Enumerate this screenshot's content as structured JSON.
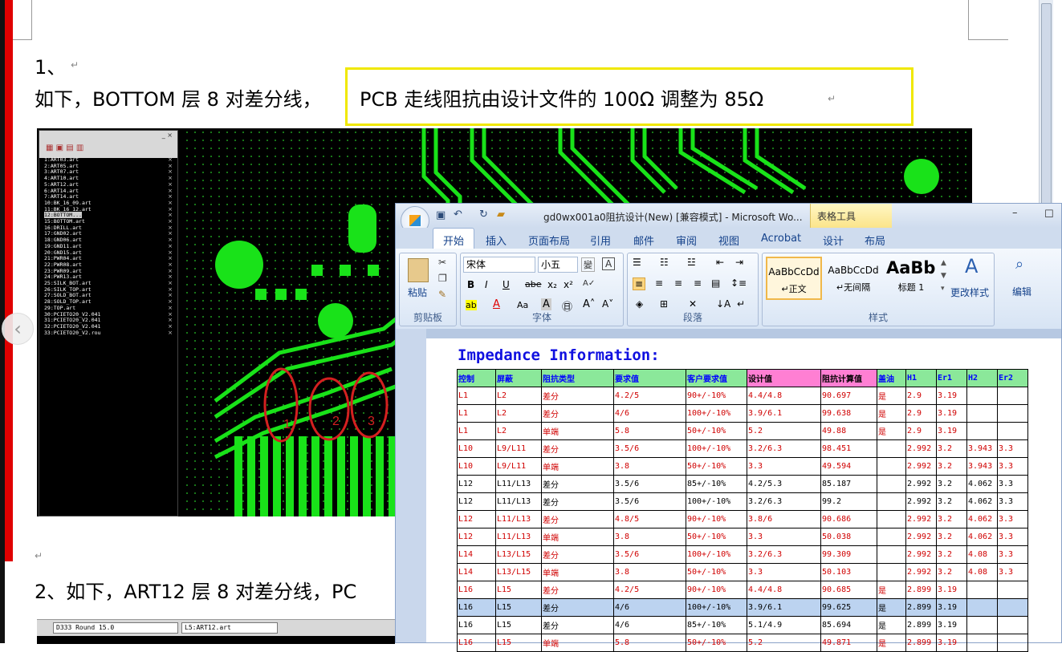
{
  "doc": {
    "item1": "1、",
    "para1_a": "如下，BOTTOM 层 8 对差分线，",
    "para1_b": "PCB 走线阻抗由设计文件的 100Ω 调整为 85Ω",
    "item2": "2、如下，ART12 层 8 对差分线，PC",
    "para_mark": "↵"
  },
  "pcb": {
    "layers": [
      "1:ART03.art",
      "2:ART05.art",
      "3:ART07.art",
      "4:ART10.art",
      "5:ART12.art",
      "6:ART14.art",
      "7:ART14.art",
      "10:BK_16_09.art",
      "11:BK_16_12.art",
      "12:BOTTOM...",
      "15:BOTTOM.art",
      "16:DRILL.art",
      "17:GND02.art",
      "18:GND06.art",
      "19:GND11.art",
      "20:GND15.art",
      "21:PWR04.art",
      "22:PWR08.art",
      "23:PWR09.art",
      "24:PWR13.art",
      "25:SILK_BOT.art",
      "26:SILK_TOP.art",
      "27:SOLD_BOT.art",
      "28:SOLD_TOP.art",
      "29:TOP.art",
      "30:PCIETO20_V2.041",
      "31:PCIETO20_V2.041",
      "32:PCIETO20_V2.041",
      "33:PCIETO20_V2.rou"
    ],
    "circle_labels": [
      "1",
      "2",
      "3"
    ],
    "bottom_toolbar": {
      "field1": "D333  Round 15.0",
      "field2": "L5:ART12.art"
    }
  },
  "word": {
    "title": "gd0wx001a0阻抗设计(New) [兼容模式] - Microsoft Wo...",
    "context_tab": "表格工具",
    "tabs": [
      "开始",
      "插入",
      "页面布局",
      "引用",
      "邮件",
      "审阅",
      "视图",
      "Acrobat",
      "设计",
      "布局"
    ],
    "paste": "粘贴",
    "font_name": "宋体",
    "font_size": "小五",
    "groups": [
      "剪贴板",
      "字体",
      "段落",
      "样式"
    ],
    "styles": [
      {
        "preview": "AaBbCcDd",
        "name": "↵正文"
      },
      {
        "preview": "AaBbCcDd",
        "name": "↵无间隔"
      },
      {
        "preview": "AaBb",
        "name": "标题 1"
      }
    ],
    "change_style": "更改样式",
    "edit": "编辑",
    "heading": "Impedance Information:",
    "columns": [
      "控制",
      "屏蔽",
      "阻抗类型",
      "要求值",
      "客户要求值",
      "设计值",
      "阻抗计算值",
      "盖油",
      "H1",
      "Er1",
      "H2",
      "Er2"
    ],
    "rows": [
      {
        "red": true,
        "sel": false,
        "c": [
          "L1",
          "L2",
          "差分",
          "4.2/5",
          "90+/-10%",
          "4.4/4.8",
          "90.697",
          "是",
          "2.9",
          "3.19",
          "",
          ""
        ]
      },
      {
        "red": true,
        "sel": false,
        "c": [
          "L1",
          "L2",
          "差分",
          "4/6",
          "100+/-10%",
          "3.9/6.1",
          "99.638",
          "是",
          "2.9",
          "3.19",
          "",
          ""
        ]
      },
      {
        "red": true,
        "sel": false,
        "c": [
          "L1",
          "L2",
          "单端",
          "5.8",
          "50+/-10%",
          "5.2",
          "49.88",
          "是",
          "2.9",
          "3.19",
          "",
          ""
        ]
      },
      {
        "red": true,
        "sel": false,
        "c": [
          "L10",
          "L9/L11",
          "差分",
          "3.5/6",
          "100+/-10%",
          "3.2/6.3",
          "98.451",
          "",
          "2.992",
          "3.2",
          "3.943",
          "3.3"
        ]
      },
      {
        "red": true,
        "sel": false,
        "c": [
          "L10",
          "L9/L11",
          "单端",
          "3.8",
          "50+/-10%",
          "3.3",
          "49.594",
          "",
          "2.992",
          "3.2",
          "3.943",
          "3.3"
        ]
      },
      {
        "red": false,
        "sel": false,
        "c": [
          "L12",
          "L11/L13",
          "差分",
          "3.5/6",
          "85+/-10%",
          "4.2/5.3",
          "85.187",
          "",
          "2.992",
          "3.2",
          "4.062",
          "3.3"
        ]
      },
      {
        "red": false,
        "sel": false,
        "c": [
          "L12",
          "L11/L13",
          "差分",
          "3.5/6",
          "100+/-10%",
          "3.2/6.3",
          "99.2",
          "",
          "2.992",
          "3.2",
          "4.062",
          "3.3"
        ]
      },
      {
        "red": true,
        "sel": false,
        "c": [
          "L12",
          "L11/L13",
          "差分",
          "4.8/5",
          "90+/-10%",
          "3.8/6",
          "90.686",
          "",
          "2.992",
          "3.2",
          "4.062",
          "3.3"
        ]
      },
      {
        "red": true,
        "sel": false,
        "c": [
          "L12",
          "L11/L13",
          "单端",
          "3.8",
          "50+/-10%",
          "3.3",
          "50.038",
          "",
          "2.992",
          "3.2",
          "4.062",
          "3.3"
        ]
      },
      {
        "red": true,
        "sel": false,
        "c": [
          "L14",
          "L13/L15",
          "差分",
          "3.5/6",
          "100+/-10%",
          "3.2/6.3",
          "99.309",
          "",
          "2.992",
          "3.2",
          "4.08",
          "3.3"
        ]
      },
      {
        "red": true,
        "sel": false,
        "c": [
          "L14",
          "L13/L15",
          "单端",
          "3.8",
          "50+/-10%",
          "3.3",
          "50.103",
          "",
          "2.992",
          "3.2",
          "4.08",
          "3.3"
        ]
      },
      {
        "red": true,
        "sel": false,
        "c": [
          "L16",
          "L15",
          "差分",
          "4.2/5",
          "90+/-10%",
          "4.4/4.8",
          "90.685",
          "是",
          "2.899",
          "3.19",
          "",
          ""
        ]
      },
      {
        "red": false,
        "sel": true,
        "c": [
          "L16",
          "L15",
          "差分",
          "4/6",
          "100+/-10%",
          "3.9/6.1",
          "99.625",
          "是",
          "2.899",
          "3.19",
          "",
          ""
        ]
      },
      {
        "red": false,
        "sel": false,
        "c": [
          "L16",
          "L15",
          "差分",
          "4/6",
          "85+/-10%",
          "5.1/4.9",
          "85.694",
          "是",
          "2.899",
          "3.19",
          "",
          ""
        ]
      },
      {
        "red": true,
        "sel": false,
        "c": [
          "L16",
          "L15",
          "单端",
          "5.8",
          "50+/-10%",
          "5.2",
          "49.871",
          "是",
          "2.899",
          "3.19",
          "",
          ""
        ]
      }
    ]
  }
}
